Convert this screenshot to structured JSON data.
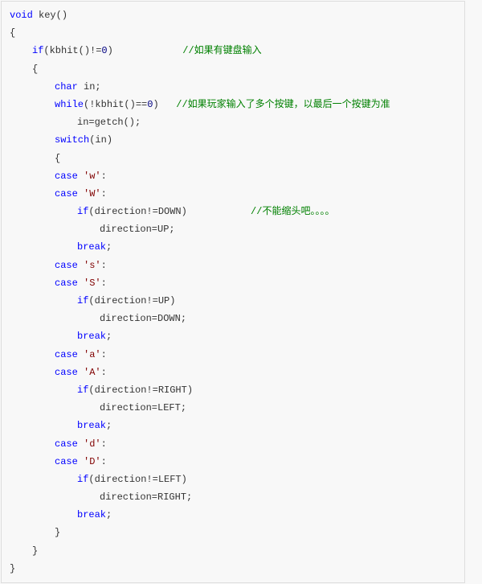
{
  "code": {
    "l0": "void",
    "l0b": " key()",
    "l1": "{",
    "l2a": "if",
    "l2b": "(kbhit()!=",
    "l2c": "0",
    "l2d": ")            ",
    "l2e": "//如果有键盘输入",
    "l3": "{",
    "l4a": "char",
    "l4b": " in;",
    "l5a": "while",
    "l5b": "(!kbhit()==",
    "l5c": "0",
    "l5d": ")   ",
    "l5e": "//如果玩家输入了多个按键，以最后一个按键为准",
    "l6": "in=getch();",
    "l7a": "switch",
    "l7b": "(in)",
    "l8": "{",
    "l9a": "case",
    "l9b": " ",
    "l9c": "'w'",
    "l9d": ":",
    "l10a": "case",
    "l10b": " ",
    "l10c": "'W'",
    "l10d": ":",
    "l11a": "if",
    "l11b": "(direction!=DOWN)           ",
    "l11c": "//不能缩头吧。。。。",
    "l12": "direction=UP;",
    "l13a": "break",
    "l13b": ";",
    "l14a": "case",
    "l14b": " ",
    "l14c": "'s'",
    "l14d": ":",
    "l15a": "case",
    "l15b": " ",
    "l15c": "'S'",
    "l15d": ":",
    "l16a": "if",
    "l16b": "(direction!=UP)",
    "l17": "direction=DOWN;",
    "l18a": "break",
    "l18b": ";",
    "l19a": "case",
    "l19b": " ",
    "l19c": "'a'",
    "l19d": ":",
    "l20a": "case",
    "l20b": " ",
    "l20c": "'A'",
    "l20d": ":",
    "l21a": "if",
    "l21b": "(direction!=RIGHT)",
    "l22": "direction=LEFT;",
    "l23a": "break",
    "l23b": ";",
    "l24a": "case",
    "l24b": " ",
    "l24c": "'d'",
    "l24d": ":",
    "l25a": "case",
    "l25b": " ",
    "l25c": "'D'",
    "l25d": ":",
    "l26a": "if",
    "l26b": "(direction!=LEFT)",
    "l27": "direction=RIGHT;",
    "l28a": "break",
    "l28b": ";",
    "l29": "}",
    "l30": "}",
    "l31": "}"
  }
}
